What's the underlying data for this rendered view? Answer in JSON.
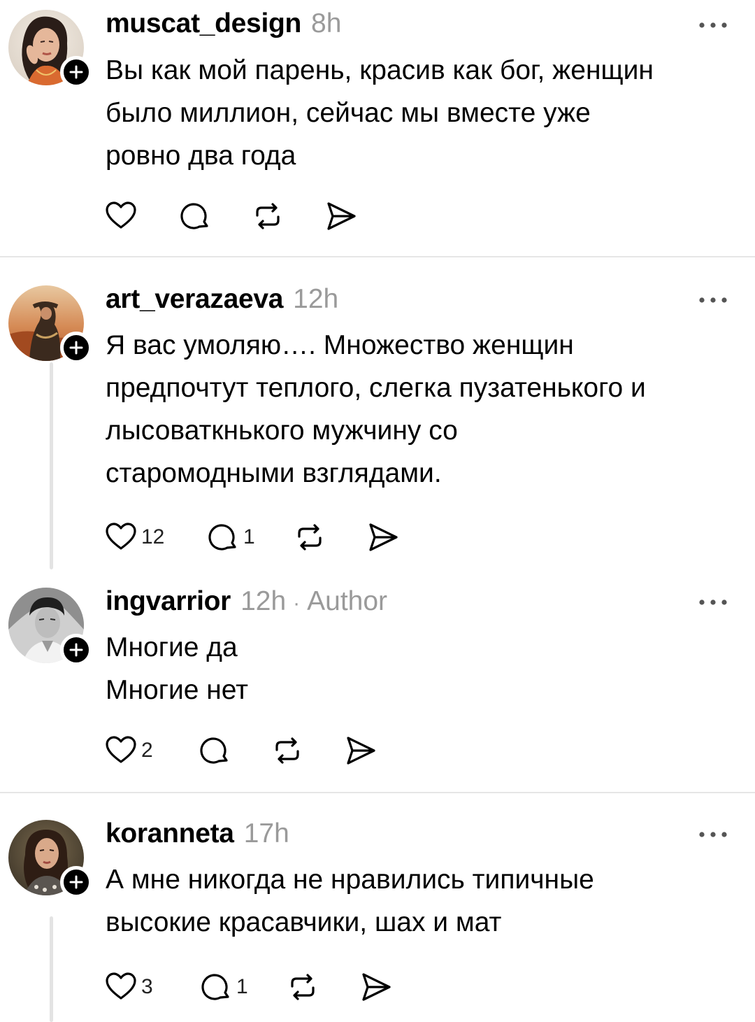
{
  "posts": [
    {
      "username": "muscat_design",
      "time": "8h",
      "lines": [
        "Вы как мой парень, красив как бог, женщин",
        "было миллион, сейчас мы вместе уже",
        "ровно два года"
      ],
      "likes": "",
      "replies": ""
    },
    {
      "username": "art_verazaeva",
      "time": "12h",
      "lines": [
        "Я вас умоляю…. Множество женщин",
        "предпочтут теплого, слегка пузатенького и",
        "лысоваткнького мужчину со",
        "старомодными взглядами."
      ],
      "likes": "12",
      "replies": "1"
    },
    {
      "username": "ingvarrior",
      "time": "12h",
      "separator": "·",
      "author_label": "Author",
      "lines": [
        "Многие да",
        "Многие нет"
      ],
      "likes": "2",
      "replies": ""
    },
    {
      "username": "koranneta",
      "time": "17h",
      "lines": [
        "А мне никогда не нравились типичные",
        "высокие красавчики, шах и мат"
      ],
      "likes": "3",
      "replies": "1"
    }
  ],
  "icons": {
    "like": "heart-icon",
    "reply": "comment-icon",
    "repost": "repost-icon",
    "share": "send-icon",
    "more": "more-icon",
    "follow": "plus-icon"
  },
  "colors": {
    "text": "#000000",
    "meta": "#9a9a9a",
    "divider": "#e6e6e6",
    "thread_line": "#e3e3e3"
  }
}
